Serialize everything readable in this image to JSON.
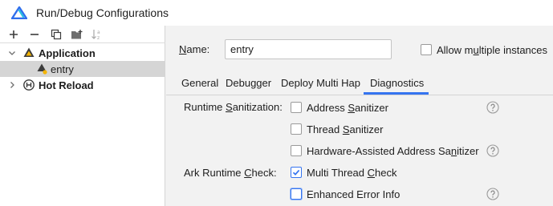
{
  "window": {
    "title": "Run/Debug Configurations"
  },
  "toolbar": {
    "add": "+",
    "remove": "−"
  },
  "tree": {
    "items": [
      {
        "label": "Application",
        "expanded": true
      },
      {
        "label": "entry",
        "selected": true
      },
      {
        "label": "Hot Reload",
        "expanded": false
      }
    ]
  },
  "form": {
    "name_label_pre": "",
    "name_label_mnemonic": "N",
    "name_label_post": "ame:",
    "name_value": "entry",
    "allow_multiple_pre": "Allow m",
    "allow_multiple_mnemonic": "u",
    "allow_multiple_post": "ltiple instances",
    "allow_multiple_checked": false
  },
  "tabs": [
    {
      "label": "General"
    },
    {
      "label": "Debugger"
    },
    {
      "label": "Deploy Multi Hap"
    },
    {
      "label": "Diagnostics",
      "active": true
    }
  ],
  "diagnostics": {
    "runtime_sanitization_pre": "Runtime ",
    "runtime_sanitization_mnemonic": "S",
    "runtime_sanitization_post": "anitization:",
    "ark_runtime_pre": "Ark Runtime ",
    "ark_runtime_mnemonic": "C",
    "ark_runtime_post": "heck:",
    "options": [
      {
        "pre": "Address ",
        "mn": "S",
        "post": "anitizer",
        "checked": false
      },
      {
        "pre": "Thread ",
        "mn": "S",
        "post": "anitizer",
        "checked": false
      },
      {
        "pre": "Hardware-Assisted Address Sa",
        "mn": "n",
        "post": "itizer",
        "checked": false
      },
      {
        "pre": "Multi Thread ",
        "mn": "C",
        "post": "heck",
        "checked": true
      },
      {
        "pre": "Enhanced Error Info",
        "mn": "",
        "post": "",
        "checked": false
      }
    ]
  },
  "colors": {
    "accent": "#3574f0",
    "logo_blue": "#2f6fed"
  }
}
